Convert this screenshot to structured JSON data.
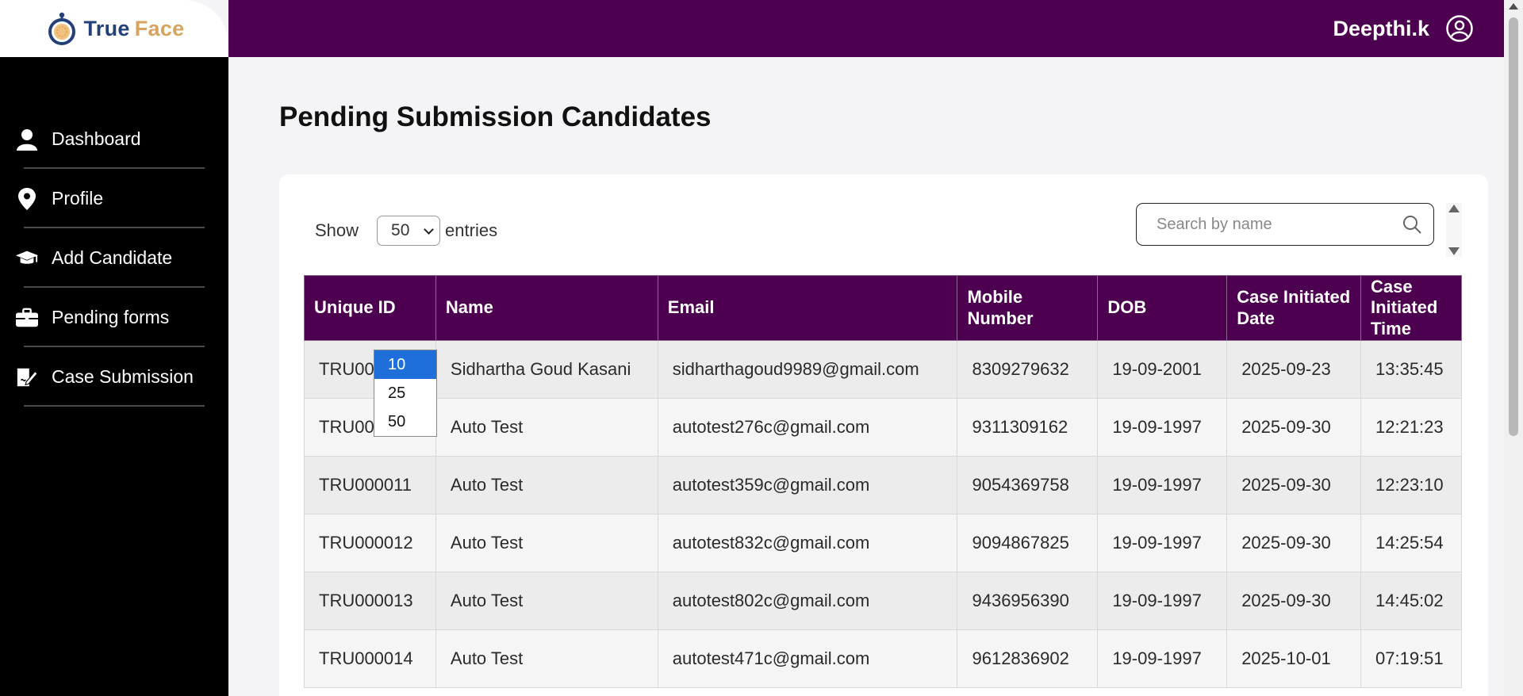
{
  "brand": {
    "name_part1": "True",
    "name_part2": "Face",
    "primary_color": "#4e0050",
    "accent_color": "#d6a45e",
    "logo_blue": "#23407a"
  },
  "header": {
    "user_name": "Deepthi.k",
    "user_icon": "user-circle-icon"
  },
  "sidebar": {
    "items": [
      {
        "label": "Dashboard",
        "icon": "user-icon"
      },
      {
        "label": "Profile",
        "icon": "location-pin-icon"
      },
      {
        "label": "Add Candidate",
        "icon": "graduation-cap-icon"
      },
      {
        "label": "Pending forms",
        "icon": "briefcase-icon"
      },
      {
        "label": "Case Submission",
        "icon": "document-sign-icon"
      }
    ]
  },
  "page": {
    "title": "Pending Submission Candidates"
  },
  "controls": {
    "show_label": "Show",
    "entries_label": "entries",
    "page_size_value": "50",
    "page_size_options": [
      "10",
      "25",
      "50"
    ],
    "search_placeholder": "Search by name"
  },
  "table": {
    "columns": [
      "Unique ID",
      "Name",
      "Email",
      "Mobile Number",
      "DOB",
      "Case Initiated Date",
      "Case Initiated Time"
    ],
    "rows": [
      [
        "TRU00",
        "Sidhartha Goud Kasani",
        "sidharthagoud9989@gmail.com",
        "8309279632",
        "19-09-2001",
        "2025-09-23",
        "13:35:45"
      ],
      [
        "TRU00",
        "Auto Test",
        "autotest276c@gmail.com",
        "9311309162",
        "19-09-1997",
        "2025-09-30",
        "12:21:23"
      ],
      [
        "TRU000011",
        "Auto Test",
        "autotest359c@gmail.com",
        "9054369758",
        "19-09-1997",
        "2025-09-30",
        "12:23:10"
      ],
      [
        "TRU000012",
        "Auto Test",
        "autotest832c@gmail.com",
        "9094867825",
        "19-09-1997",
        "2025-09-30",
        "14:25:54"
      ],
      [
        "TRU000013",
        "Auto Test",
        "autotest802c@gmail.com",
        "9436956390",
        "19-09-1997",
        "2025-09-30",
        "14:45:02"
      ],
      [
        "TRU000014",
        "Auto Test",
        "autotest471c@gmail.com",
        "9612836902",
        "19-09-1997",
        "2025-10-01",
        "07:19:51"
      ]
    ]
  }
}
